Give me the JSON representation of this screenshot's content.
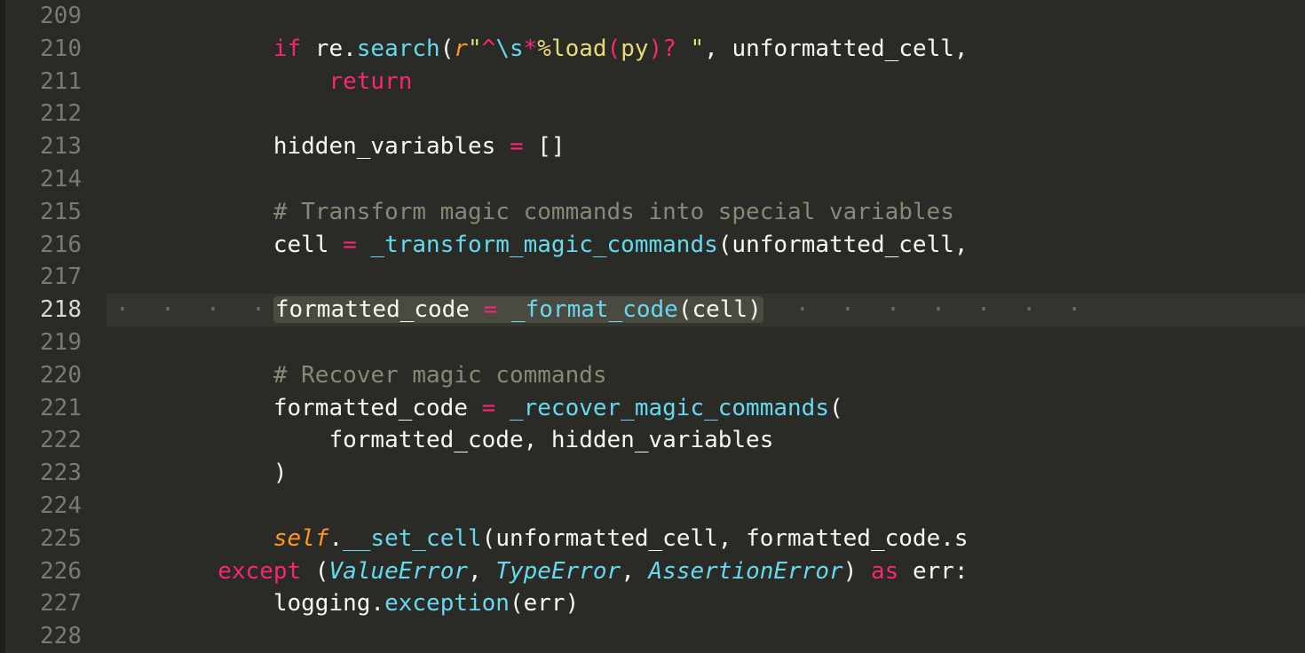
{
  "editor": {
    "language": "python",
    "visible_range": {
      "start": 209,
      "end": 228
    },
    "active_line": 218,
    "colors": {
      "background": "#2a2a26",
      "gutter_fg": "#7a7a70",
      "gutter_active_fg": "#d8d8d0",
      "keyword": "#f92672",
      "string": "#e6db74",
      "call": "#66d9ef",
      "class": "#66d9ef",
      "param": "#fd971f",
      "comment": "#888877",
      "identifier": "#f8f8f2",
      "active_line_bg": "rgba(100,100,90,0.18)",
      "active_segment_bg": "#4a4a40"
    },
    "lines": [
      {
        "n": 209,
        "raw": ""
      },
      {
        "n": 210,
        "raw": "            if re.search(r\"^\\s*%load(py)? \", unformatted_cell,",
        "tokens": [
          {
            "t": "ident",
            "v": "            "
          },
          {
            "t": "kw",
            "v": "if"
          },
          {
            "t": "ident",
            "v": " re."
          },
          {
            "t": "call",
            "v": "search"
          },
          {
            "t": "ident",
            "v": "("
          },
          {
            "t": "fnarg",
            "v": "r"
          },
          {
            "t": "str",
            "v": "\""
          },
          {
            "t": "op",
            "v": "^"
          },
          {
            "t": "call",
            "v": "\\s"
          },
          {
            "t": "op",
            "v": "*"
          },
          {
            "t": "str",
            "v": "%load"
          },
          {
            "t": "op",
            "v": "("
          },
          {
            "t": "str",
            "v": "py"
          },
          {
            "t": "op",
            "v": ")?"
          },
          {
            "t": "str",
            "v": " \""
          },
          {
            "t": "ident",
            "v": ", unformatted_cell,"
          }
        ]
      },
      {
        "n": 211,
        "raw": "                return",
        "tokens": [
          {
            "t": "ident",
            "v": "                "
          },
          {
            "t": "kw",
            "v": "return"
          }
        ]
      },
      {
        "n": 212,
        "raw": "",
        "tokens": []
      },
      {
        "n": 213,
        "raw": "            hidden_variables = []",
        "tokens": [
          {
            "t": "ident",
            "v": "            hidden_variables "
          },
          {
            "t": "kw",
            "v": "="
          },
          {
            "t": "ident",
            "v": " []"
          }
        ]
      },
      {
        "n": 214,
        "raw": "",
        "tokens": []
      },
      {
        "n": 215,
        "raw": "            # Transform magic commands into special variables",
        "tokens": [
          {
            "t": "ident",
            "v": "            "
          },
          {
            "t": "cmt",
            "v": "# Transform magic commands into special variables"
          }
        ]
      },
      {
        "n": 216,
        "raw": "            cell = _transform_magic_commands(unformatted_cell,",
        "tokens": [
          {
            "t": "ident",
            "v": "            cell "
          },
          {
            "t": "kw",
            "v": "="
          },
          {
            "t": "ident",
            "v": " "
          },
          {
            "t": "call",
            "v": "_transform_magic_commands"
          },
          {
            "t": "ident",
            "v": "(unformatted_cell,"
          }
        ]
      },
      {
        "n": 217,
        "raw": "",
        "tokens": []
      },
      {
        "n": 218,
        "raw": "            formatted_code = _format_code(cell)",
        "tokens": [
          {
            "t": "ident",
            "v": "            "
          },
          {
            "t": "ident",
            "v": "formatted_code",
            "seg": true
          },
          {
            "t": "ident",
            "v": " ",
            "seg": true,
            "nospace": true
          },
          {
            "t": "kw",
            "v": "=",
            "seg": true
          },
          {
            "t": "ident",
            "v": " ",
            "seg": true,
            "nospace": true
          },
          {
            "t": "call",
            "v": "_format_code",
            "seg": true
          },
          {
            "t": "ident",
            "v": "(cell)",
            "seg": true
          }
        ]
      },
      {
        "n": 219,
        "raw": "",
        "tokens": []
      },
      {
        "n": 220,
        "raw": "            # Recover magic commands",
        "tokens": [
          {
            "t": "ident",
            "v": "            "
          },
          {
            "t": "cmt",
            "v": "# Recover magic commands"
          }
        ]
      },
      {
        "n": 221,
        "raw": "            formatted_code = _recover_magic_commands(",
        "tokens": [
          {
            "t": "ident",
            "v": "            formatted_code "
          },
          {
            "t": "kw",
            "v": "="
          },
          {
            "t": "ident",
            "v": " "
          },
          {
            "t": "call",
            "v": "_recover_magic_commands"
          },
          {
            "t": "ident",
            "v": "("
          }
        ]
      },
      {
        "n": 222,
        "raw": "                formatted_code, hidden_variables",
        "tokens": [
          {
            "t": "ident",
            "v": "                formatted_code, hidden_variables"
          }
        ]
      },
      {
        "n": 223,
        "raw": "            )",
        "tokens": [
          {
            "t": "ident",
            "v": "            )"
          }
        ]
      },
      {
        "n": 224,
        "raw": "",
        "tokens": []
      },
      {
        "n": 225,
        "raw": "            self.__set_cell(unformatted_cell, formatted_code.s",
        "tokens": [
          {
            "t": "ident",
            "v": "            "
          },
          {
            "t": "fnarg",
            "v": "self"
          },
          {
            "t": "ident",
            "v": "."
          },
          {
            "t": "call",
            "v": "__set_cell"
          },
          {
            "t": "ident",
            "v": "(unformatted_cell, formatted_code.s"
          }
        ]
      },
      {
        "n": 226,
        "raw": "        except (ValueError, TypeError, AssertionError) as err:",
        "tokens": [
          {
            "t": "ident",
            "v": "        "
          },
          {
            "t": "kw",
            "v": "except"
          },
          {
            "t": "ident",
            "v": " ("
          },
          {
            "t": "cls",
            "v": "ValueError"
          },
          {
            "t": "ident",
            "v": ", "
          },
          {
            "t": "cls",
            "v": "TypeError"
          },
          {
            "t": "ident",
            "v": ", "
          },
          {
            "t": "cls",
            "v": "AssertionError"
          },
          {
            "t": "ident",
            "v": ") "
          },
          {
            "t": "kw",
            "v": "as"
          },
          {
            "t": "ident",
            "v": " err:"
          }
        ]
      },
      {
        "n": 227,
        "raw": "            logging.exception(err)",
        "tokens": [
          {
            "t": "ident",
            "v": "            logging."
          },
          {
            "t": "call",
            "v": "exception"
          },
          {
            "t": "ident",
            "v": "(err)"
          }
        ]
      },
      {
        "n": 228,
        "raw": "",
        "tokens": []
      }
    ]
  }
}
